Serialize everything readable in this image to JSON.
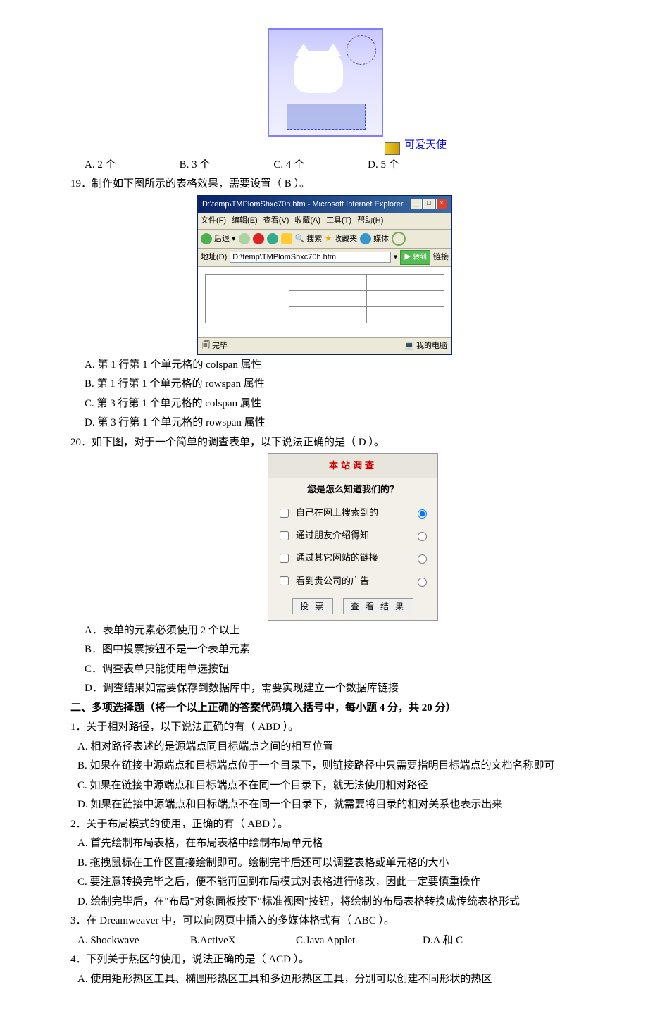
{
  "kitty": {
    "link_label": "可爱天使"
  },
  "q18_opts": {
    "a": "A. 2 个",
    "b": "B. 3 个",
    "c": "C. 4 个",
    "d": "D. 5 个"
  },
  "q19": {
    "stem": "19．制作如下图所示的表格效果，需要设置（ B ）。",
    "a": "A.   第 1 行第 1 个单元格的 colspan 属性",
    "b": "B.   第 1 行第 1 个单元格的 rowspan 属性",
    "c": "C.   第 3 行第 1 个单元格的 colspan 属性",
    "d": "D.   第 3 行第 1 个单元格的 rowspan 属性"
  },
  "ie": {
    "title": "D:\\temp\\TMPlomShxc70h.htm - Microsoft Internet Explorer",
    "menu": {
      "file": "文件(F)",
      "edit": "编辑(E)",
      "view": "查看(V)",
      "fav": "收藏(A)",
      "tools": "工具(T)",
      "help": "帮助(H)"
    },
    "back": "后退",
    "search": "搜索",
    "favorites": "收藏夹",
    "media": "媒体",
    "addr_label": "地址(D)",
    "addr_value": "D:\\temp\\TMPlomShxc70h.htm",
    "go": "转到",
    "links": "链接",
    "done": "完毕",
    "zone": "我的电脑"
  },
  "q20": {
    "stem": "20．如下图，对于一个简单的调查表单，以下说法正确的是（ D   ）。",
    "a": "A．表单的元素必须使用 2 个以上",
    "b": "B．图中投票按钮不是一个表单元素",
    "c": "C．调查表单只能使用单选按钮",
    "d": "D．调查结果如需要保存到数据库中，需要实现建立一个数据库链接"
  },
  "survey": {
    "title": "本站调查",
    "question": "您是怎么知道我们的？",
    "o1": "自己在网上搜索到的",
    "o2": "通过朋友介绍得知",
    "o3": "通过其它网站的链接",
    "o4": "看到贵公司的广告",
    "vote": "投 票",
    "result": "查 看 结 果"
  },
  "section2": {
    "header": "二、多项选择题（将一个以上正确的答案代码填入括号中，每小题 4 分，共 20 分）",
    "q1": {
      "stem": "1．关于相对路径，以下说法正确的有（   ABD   ）。",
      "a": "A.   相对路径表述的是源端点同目标端点之间的相互位置",
      "b": "B.   如果在链接中源端点和目标端点位于一个目录下，则链接路径中只需要指明目标端点的文档名称即可",
      "c": "C.   如果在链接中源端点和目标端点不在同一个目录下，就无法使用相对路径",
      "d": "D.   如果在链接中源端点和目标端点不在同一个目录下，就需要将目录的相对关系也表示出来"
    },
    "q2": {
      "stem": "2．关于布局模式的使用，正确的有（     ABD     ）。",
      "a": "A.   首先绘制布局表格，在布局表格中绘制布局单元格",
      "b": "B.   拖拽鼠标在工作区直接绘制即可。绘制完毕后还可以调整表格或单元格的大小",
      "c": "C.   要注意转换完毕之后，便不能再回到布局模式对表格进行修改，因此一定要慎重操作",
      "d": "D.   绘制完毕后，在\"布局\"对象面板按下\"标准视图\"按钮，将绘制的布局表格转换成传统表格形式"
    },
    "q3": {
      "stem": "3．在 Dreamweaver 中，可以向网页中插入的多媒体格式有（   ABC   ）。",
      "a": "A.   Shockwave",
      "b": "B.ActiveX",
      "c": "C.Java Applet",
      "d": "D.A 和 C"
    },
    "q4": {
      "stem": "4．下列关于热区的使用，说法正确的是（   ACD   ）。",
      "a": "A.   使用矩形热区工具、椭圆形热区工具和多边形热区工具，分别可以创建不同形状的热区"
    }
  }
}
